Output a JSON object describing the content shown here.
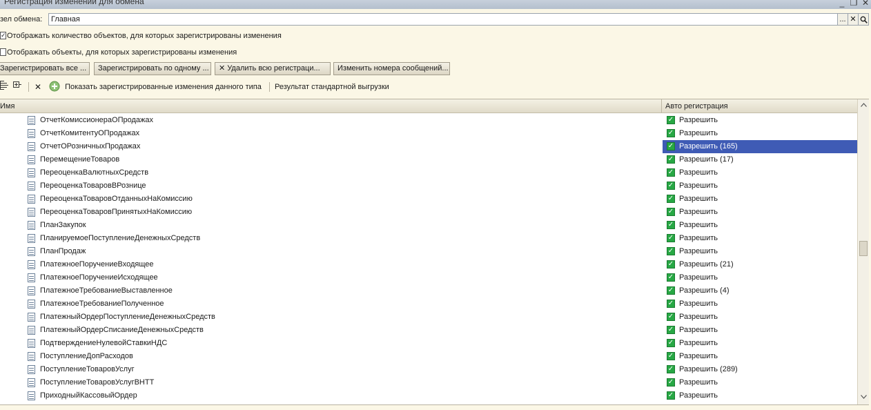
{
  "window": {
    "title": "Регистрация изменений для обмена",
    "minimize": "_",
    "restore": "❐",
    "close": "✕"
  },
  "node": {
    "label": "зел обмена:",
    "value": "Главная",
    "btn_select": "...",
    "btn_clear": "✕",
    "btn_open": "🔍"
  },
  "options": {
    "show_count": "Отображать количество объектов, для которых зарегистрированы изменения",
    "show_objects": "Отображать объекты, для которых зарегистрированы изменения"
  },
  "buttons": {
    "register_all": "Зарегистрировать все ...",
    "register_one": "Зарегистрировать по одному ...",
    "delete_all": "Удалить всю регистраци...",
    "change_numbers": "Изменить номера сообщений..."
  },
  "toolbar": {
    "delete_icon": "✕",
    "show_changes": "Показать зарегистрированные изменения данного типа",
    "standard_export": "Результат стандартной выгрузки"
  },
  "table": {
    "col_name": "Имя",
    "col_auto": "Авто регистрация",
    "rows": [
      {
        "name": "ОтчетКомиссионераОПродажах",
        "auto": "Разрешить",
        "selected": false
      },
      {
        "name": "ОтчетКомитентуОПродажах",
        "auto": "Разрешить",
        "selected": false
      },
      {
        "name": "ОтчетОРозничныхПродажах",
        "auto": "Разрешить (165)",
        "selected": true
      },
      {
        "name": "ПеремещениеТоваров",
        "auto": "Разрешить (17)",
        "selected": false
      },
      {
        "name": "ПереоценкаВалютныхСредств",
        "auto": "Разрешить",
        "selected": false
      },
      {
        "name": "ПереоценкаТоваровВРознице",
        "auto": "Разрешить",
        "selected": false
      },
      {
        "name": "ПереоценкаТоваровОтданныхНаКомиссию",
        "auto": "Разрешить",
        "selected": false
      },
      {
        "name": "ПереоценкаТоваровПринятыхНаКомиссию",
        "auto": "Разрешить",
        "selected": false
      },
      {
        "name": "ПланЗакупок",
        "auto": "Разрешить",
        "selected": false
      },
      {
        "name": "ПланируемоеПоступлениеДенежныхСредств",
        "auto": "Разрешить",
        "selected": false
      },
      {
        "name": "ПланПродаж",
        "auto": "Разрешить",
        "selected": false
      },
      {
        "name": "ПлатежноеПоручениеВходящее",
        "auto": "Разрешить (21)",
        "selected": false
      },
      {
        "name": "ПлатежноеПоручениеИсходящее",
        "auto": "Разрешить",
        "selected": false
      },
      {
        "name": "ПлатежноеТребованиеВыставленное",
        "auto": "Разрешить (4)",
        "selected": false
      },
      {
        "name": "ПлатежноеТребованиеПолученное",
        "auto": "Разрешить",
        "selected": false
      },
      {
        "name": "ПлатежныйОрдерПоступлениеДенежныхСредств",
        "auto": "Разрешить",
        "selected": false
      },
      {
        "name": "ПлатежныйОрдерСписаниеДенежныхСредств",
        "auto": "Разрешить",
        "selected": false
      },
      {
        "name": "ПодтверждениеНулевойСтавкиНДС",
        "auto": "Разрешить",
        "selected": false
      },
      {
        "name": "ПоступлениеДопРасходов",
        "auto": "Разрешить",
        "selected": false
      },
      {
        "name": "ПоступлениеТоваровУслуг",
        "auto": "Разрешить (289)",
        "selected": false
      },
      {
        "name": "ПоступлениеТоваровУслугВНТТ",
        "auto": "Разрешить",
        "selected": false
      },
      {
        "name": "ПриходныйКассовыйОрдер",
        "auto": "Разрешить",
        "selected": false
      }
    ]
  },
  "colors": {
    "background": "#fbf7e6",
    "selection": "#3f5bb5",
    "checkbox_green": "#27a844"
  }
}
